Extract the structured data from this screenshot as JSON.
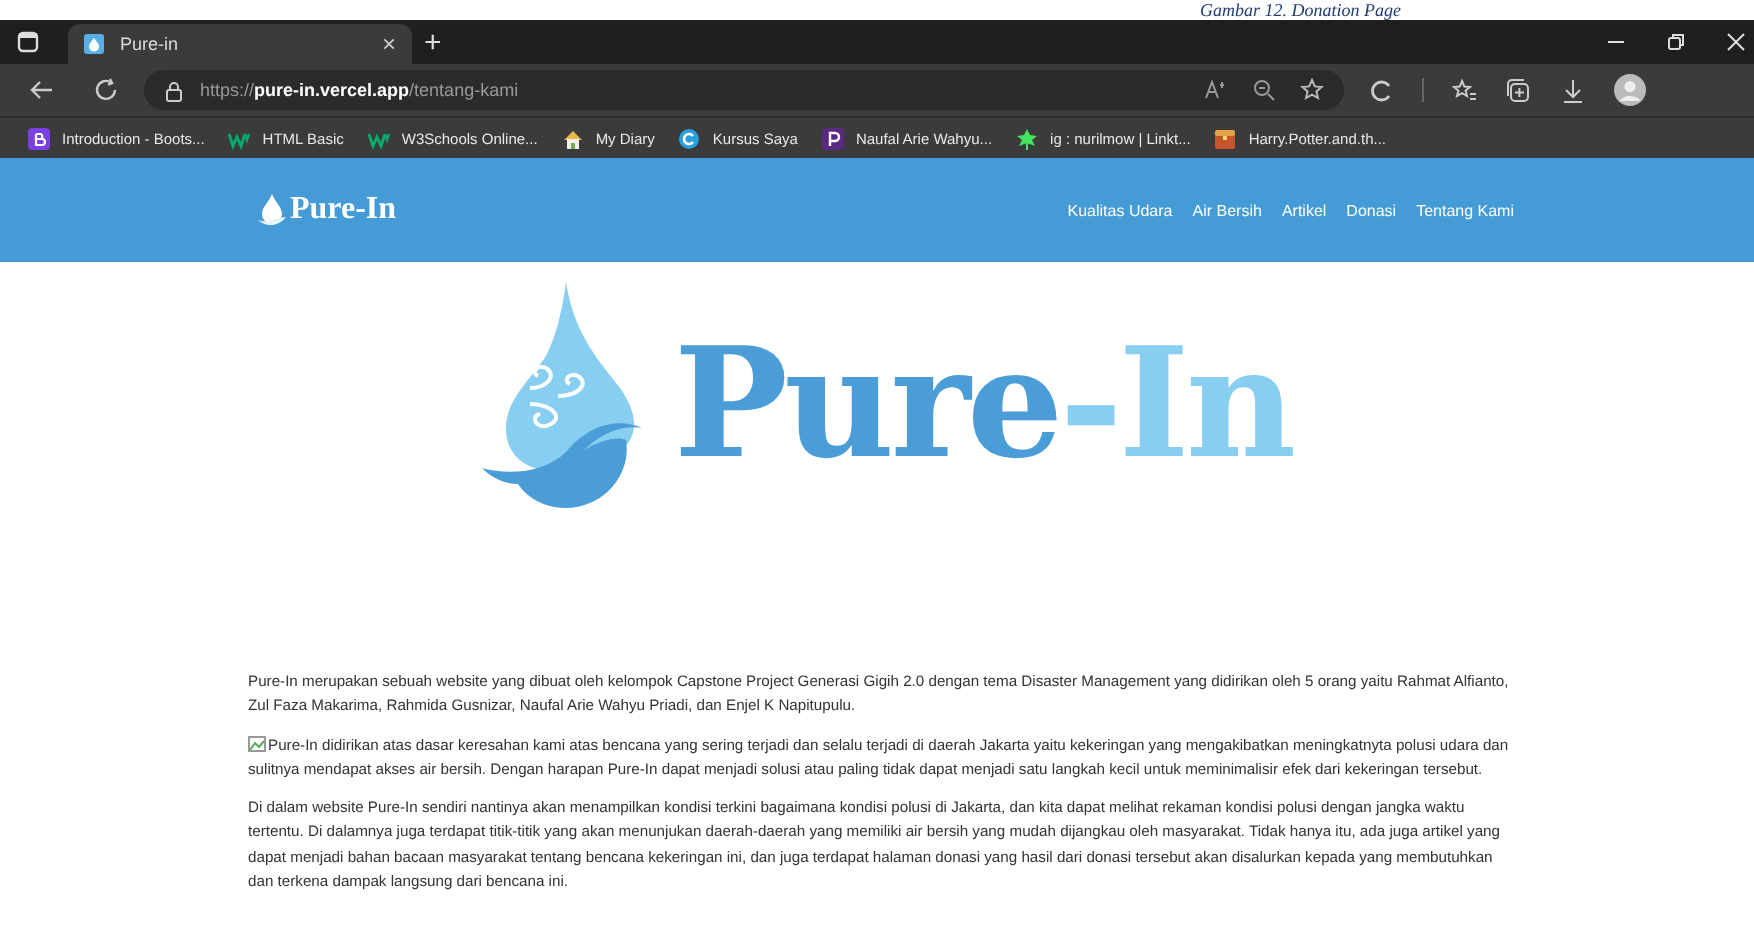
{
  "caption": "Gambar 12. Donation Page",
  "tabs": [
    {
      "title": "Pure-in",
      "selected": true,
      "close": "×"
    }
  ],
  "new_tab": "+",
  "address": {
    "scheme": "https://",
    "host": "pure-in.vercel.app",
    "path": "/tentang-kami"
  },
  "bookmarks": [
    {
      "label": "Introduction - Boots...",
      "kind": "b"
    },
    {
      "label": "HTML Basic",
      "kind": "w"
    },
    {
      "label": "W3Schools Online...",
      "kind": "w"
    },
    {
      "label": "My Diary",
      "kind": "house"
    },
    {
      "label": "Kursus Saya",
      "kind": "c"
    },
    {
      "label": "Naufal Arie Wahyu...",
      "kind": "p"
    },
    {
      "label": "ig : nurilmow | Linkt...",
      "kind": "tree"
    },
    {
      "label": "Harry.Potter.and.th...",
      "kind": "chest"
    }
  ],
  "navbar": {
    "brand": "Pure-In",
    "links": [
      "Kualitas Udara",
      "Air Bersih",
      "Artikel",
      "Donasi",
      "Tentang Kami"
    ]
  },
  "logo": {
    "parts": [
      {
        "text": "Pure",
        "color": "#4a9dd6"
      },
      {
        "text": "-In",
        "color": "#87cef0"
      }
    ]
  },
  "paragraphs": [
    {
      "text": "Pure-In merupakan sebuah website yang dibuat oleh kelompok Capstone Project Generasi Gigih 2.0 dengan tema Disaster Management yang didirikan oleh 5 orang yaitu Rahmat Alfianto, Zul Faza Makarima, Rahmida Gusnizar, Naufal Arie Wahyu Priadi, dan Enjel K Napitupulu.",
      "broken_image": false
    },
    {
      "text": "Pure-In didirikan atas dasar keresahan kami atas bencana yang sering terjadi dan selalu terjadi di daerah Jakarta yaitu kekeringan yang mengakibatkan meningkatnyta polusi udara dan sulitnya mendapat akses air bersih. Dengan harapan Pure-In dapat menjadi solusi atau paling tidak dapat menjadi satu langkah kecil untuk meminimalisir efek dari kekeringan tersebut.",
      "broken_image": true
    },
    {
      "text": "Di dalam website Pure-In sendiri nantinya akan menampilkan kondisi terkini bagaimana kondisi polusi di Jakarta, dan kita dapat melihat rekaman kondisi polusi dengan jangka waktu tertentu. Di dalamnya juga terdapat titik-titik yang akan menunjukan daerah-daerah yang memiliki air bersih yang mudah dijangkau oleh masyarakat. Tidak hanya itu, ada juga artikel yang dapat menjadi bahan bacaan masyarakat tentang bencana kekeringan ini, dan juga terdapat halaman donasi yang hasil dari donasi tersebut akan disalurkan kepada yang membutuhkan dan terkena dampak langsung dari bencana ini.",
      "broken_image": false
    }
  ]
}
